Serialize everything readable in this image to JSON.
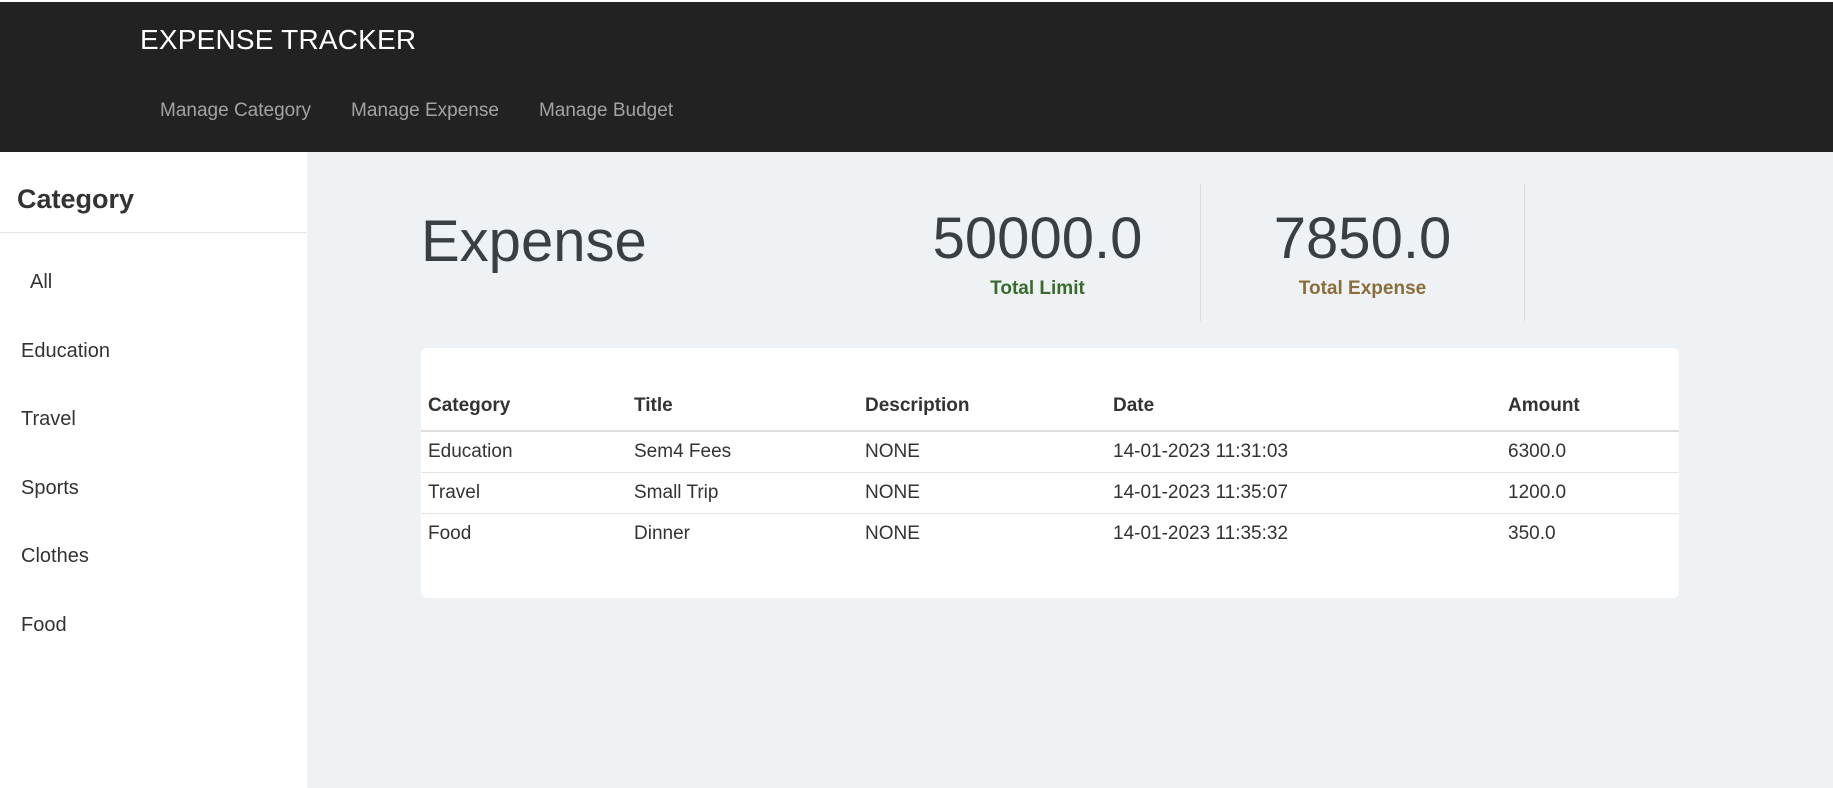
{
  "app": {
    "brand": "EXPENSE TRACKER",
    "nav": [
      "Manage Category",
      "Manage Expense",
      "Manage Budget"
    ]
  },
  "sidebar": {
    "title": "Category",
    "items": [
      "All",
      "Education",
      "Travel",
      "Sports",
      "Clothes",
      "Food"
    ]
  },
  "main": {
    "title": "Expense",
    "stats": {
      "limit": {
        "value": "50000.0",
        "label": "Total Limit"
      },
      "expense": {
        "value": "7850.0",
        "label": "Total Expense"
      }
    },
    "table": {
      "headers": [
        "Category",
        "Title",
        "Description",
        "Date",
        "Amount"
      ],
      "rows": [
        [
          "Education",
          "Sem4 Fees",
          "NONE",
          "14-01-2023 11:31:03",
          "6300.0"
        ],
        [
          "Travel",
          "Small Trip",
          "NONE",
          "14-01-2023 11:35:07",
          "1200.0"
        ],
        [
          "Food",
          "Dinner",
          "NONE",
          "14-01-2023 11:35:32",
          "350.0"
        ]
      ]
    }
  },
  "colors": {
    "topbar": "#222222",
    "nav_text": "#a3a3a3",
    "main_bg": "#eef2f5",
    "limit_label": "#3a6b2c",
    "expense_label": "#8a6d3b"
  }
}
